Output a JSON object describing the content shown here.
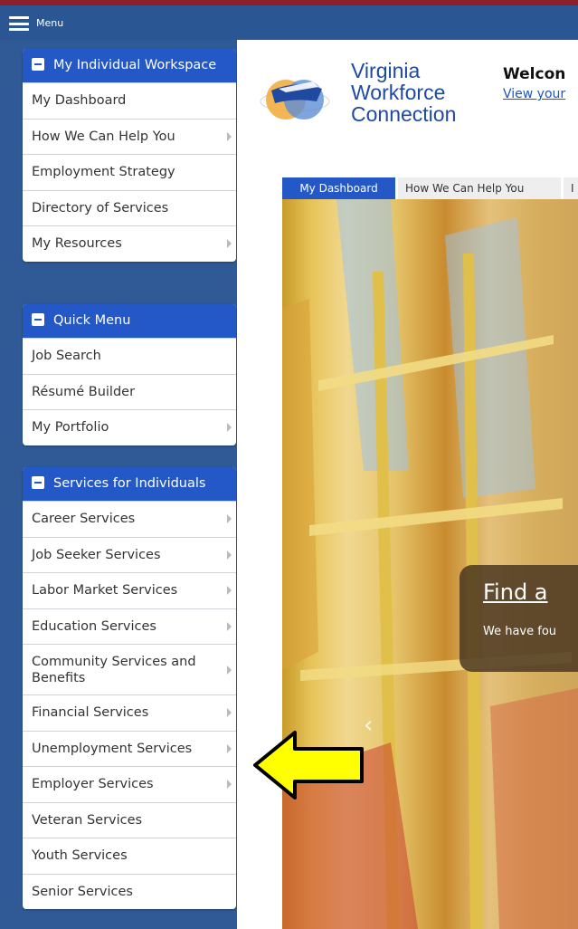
{
  "topbar": {
    "menu_label": "Menu"
  },
  "panels": [
    {
      "title": "My Individual Workspace",
      "items": [
        {
          "label": "My Dashboard",
          "submenu": false
        },
        {
          "label": "How We Can Help You",
          "submenu": true
        },
        {
          "label": "Employment Strategy",
          "submenu": false
        },
        {
          "label": "Directory of Services",
          "submenu": false
        },
        {
          "label": "My Resources",
          "submenu": true
        }
      ]
    },
    {
      "title": "Quick Menu",
      "items": [
        {
          "label": "Job Search",
          "submenu": false
        },
        {
          "label": "Résumé Builder",
          "submenu": false
        },
        {
          "label": "My Portfolio",
          "submenu": true
        }
      ]
    },
    {
      "title": "Services for Individuals",
      "items": [
        {
          "label": "Career Services",
          "submenu": true
        },
        {
          "label": "Job Seeker Services",
          "submenu": true
        },
        {
          "label": "Labor Market Services",
          "submenu": true
        },
        {
          "label": "Education Services",
          "submenu": true
        },
        {
          "label": "Community Services and Benefits",
          "submenu": true
        },
        {
          "label": "Financial Services",
          "submenu": true
        },
        {
          "label": "Unemployment Services",
          "submenu": true
        },
        {
          "label": "Employer Services",
          "submenu": true
        },
        {
          "label": "Veteran Services",
          "submenu": false
        },
        {
          "label": "Youth Services",
          "submenu": false
        },
        {
          "label": "Senior Services",
          "submenu": false
        }
      ]
    }
  ],
  "brand": {
    "line1": "Virginia",
    "line2": "Workforce",
    "line3": "Connection"
  },
  "header": {
    "welcome": "Welcon",
    "view_link": "View your"
  },
  "tabs": [
    {
      "label": "My Dashboard",
      "active": true
    },
    {
      "label": "How We Can Help You",
      "active": false
    },
    {
      "label": "I",
      "active": false
    }
  ],
  "hero": {
    "title": "Find a",
    "subtitle": "We have fou"
  },
  "colors": {
    "sidebar_bg": "#2f5a96",
    "panel_header": "#2458c6",
    "tab_active": "#2458c6",
    "annotation_arrow": "#ffff00"
  }
}
